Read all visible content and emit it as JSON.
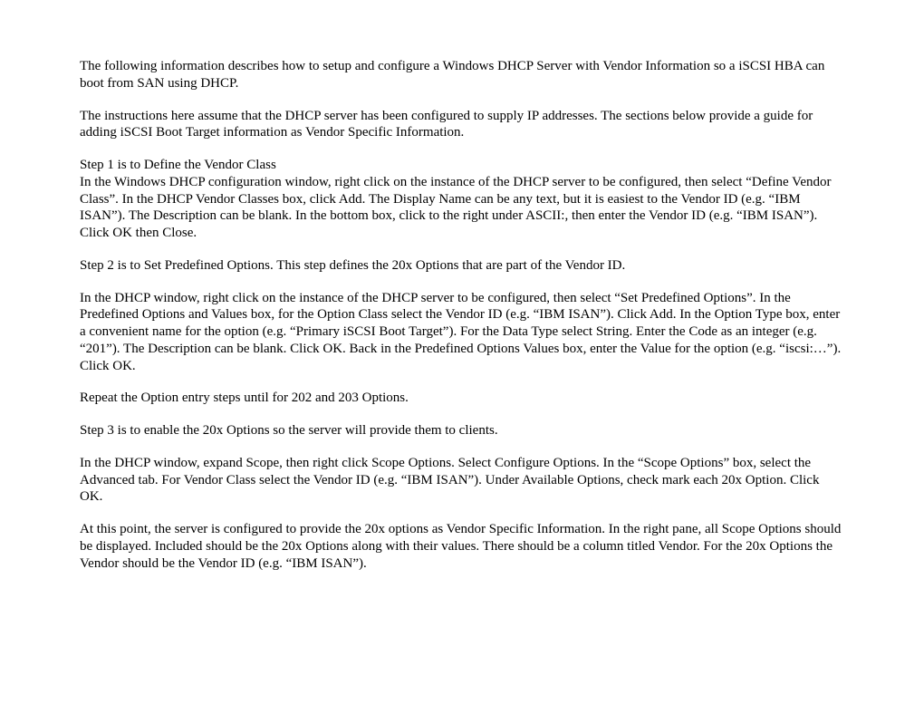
{
  "paragraphs": {
    "p1": "The following information describes how to setup and configure a Windows  DHCP Server with Vendor Information so a iSCSI HBA can boot from SAN using DHCP.",
    "p2": "The instructions here assume that the DHCP server has been configured to supply IP addresses.  The sections below provide a guide for adding iSCSI Boot Target information as Vendor Specific Information.",
    "p3": "Step 1 is to Define the Vendor Class\nIn the Windows DHCP configuration window, right click on the instance of the DHCP server to be configured, then select “Define Vendor Class”.  In the DHCP Vendor Classes box, click Add.  The Display Name can be any text, but it is easiest to the Vendor ID (e.g. “IBM ISAN”).  The Description can be blank.  In the bottom box, click to the right under ASCII:, then enter the Vendor ID (e.g. “IBM ISAN”).  Click OK then Close.",
    "p4": "Step 2 is to Set Predefined Options.  This step defines the 20x Options that are part of the Vendor ID.",
    "p5": "In the DHCP window, right click on the instance of the DHCP server to be configured, then select “Set Predefined Options”.  In the Predefined Options and Values box, for the Option Class select the Vendor ID (e.g. “IBM ISAN”).  Click Add.  In the Option Type box, enter a convenient name for the option (e.g. “Primary iSCSI Boot Target”).  For the Data Type select String. Enter the Code as an integer (e.g. “201”).  The Description can be blank.  Click OK.   Back in the Predefined Options Values box, enter the Value for the option (e.g. “iscsi:…”).  Click OK.",
    "p6": "Repeat the Option entry steps until for 202 and 203 Options.",
    "p7": "Step 3 is to enable the 20x Options so the server will provide them to clients.",
    "p8": "In the DHCP window, expand Scope, then right click Scope Options.  Select Configure Options.  In the “Scope Options” box, select the Advanced tab.  For Vendor Class select the Vendor ID (e.g. “IBM ISAN”).  Under Available Options, check mark each 20x Option.  Click OK.",
    "p9": "At this point, the server is configured to provide the 20x options as Vendor Specific Information.  In the right pane, all Scope Options should be displayed.  Included should be the 20x Options along with their values.  There should be a column titled Vendor.  For the 20x Options the Vendor should be the Vendor ID (e.g. “IBM ISAN”)."
  }
}
